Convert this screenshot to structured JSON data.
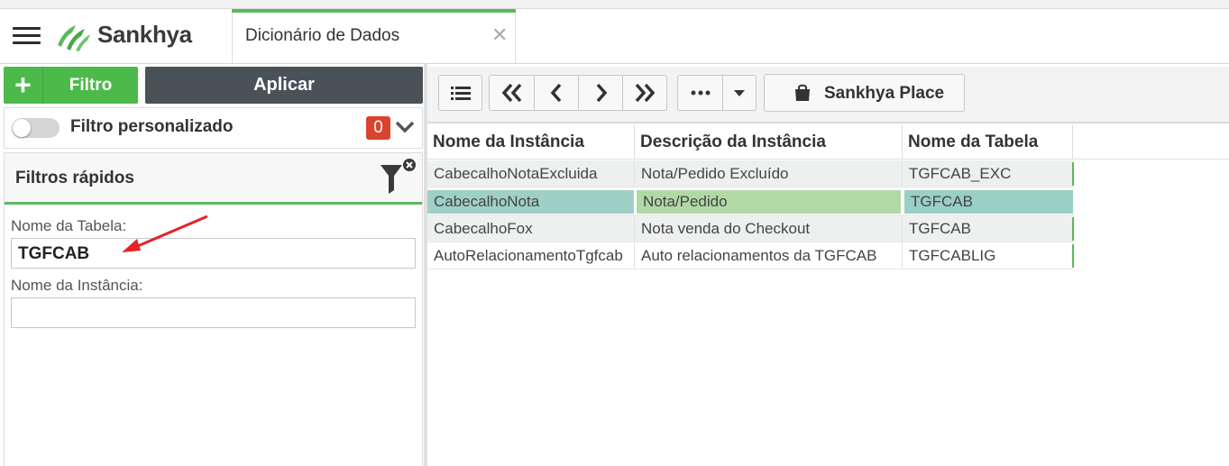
{
  "app": {
    "logo_text": "Sankhya",
    "brand_color": "#5cb85c"
  },
  "tab": {
    "title": "Dicionário de Dados",
    "close_icon": "✕"
  },
  "left_panel": {
    "filter_button": {
      "label": "Filtro",
      "plus": "+"
    },
    "apply_button": {
      "label": "Aplicar"
    },
    "custom_filter": {
      "label": "Filtro personalizado",
      "count": "0",
      "toggle_on": false
    },
    "quick_filters": {
      "title": "Filtros rápidos",
      "fields": [
        {
          "label": "Nome da Tabela:",
          "value": "TGFCAB"
        },
        {
          "label": "Nome da Instância:",
          "value": ""
        }
      ]
    }
  },
  "toolbar": {
    "buttons": [
      "list-view",
      "first",
      "previous",
      "next",
      "last",
      "more",
      "dropdown"
    ],
    "place_label": "Sankhya Place"
  },
  "grid": {
    "columns": [
      "Nome da Instância",
      "Descrição da Instância",
      "Nome da Tabela"
    ],
    "rows": [
      {
        "cells": [
          "CabecalhoNotaExcluida",
          "Nota/Pedido Excluído",
          "TGFCAB_EXC"
        ],
        "selected": false
      },
      {
        "cells": [
          "CabecalhoNota",
          "Nota/Pedido",
          "TGFCAB"
        ],
        "selected": true
      },
      {
        "cells": [
          "CabecalhoFox",
          "Nota venda do Checkout",
          "TGFCAB"
        ],
        "selected": false
      },
      {
        "cells": [
          "AutoRelacionamentoTgfcab",
          "Auto relacionamentos da TGFCAB",
          "TGFCABLIG"
        ],
        "selected": false
      }
    ],
    "selected_colors": [
      "#9fd0c6",
      "#b0d9a6",
      "#99cfc4"
    ]
  }
}
